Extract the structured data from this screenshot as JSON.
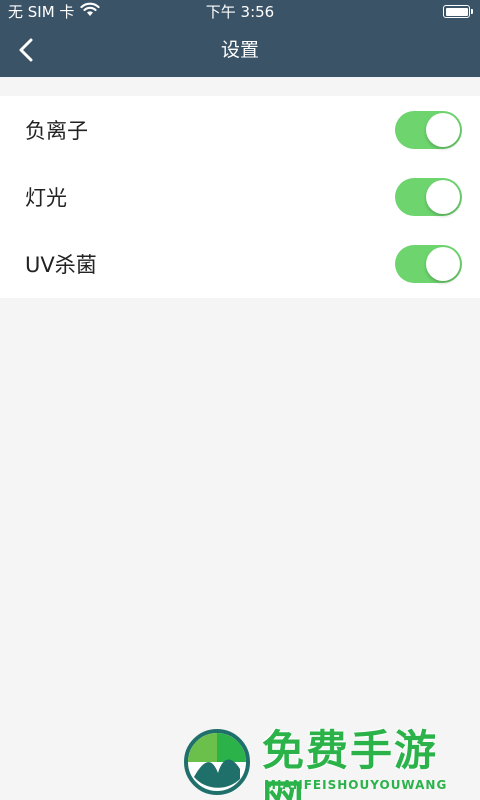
{
  "status_bar": {
    "carrier": "无 SIM 卡",
    "time": "下午 3:56",
    "wifi_icon": "wifi-icon",
    "battery_icon": "battery-icon"
  },
  "nav": {
    "title": "设置",
    "back_icon": "chevron-left-icon"
  },
  "settings": [
    {
      "label": "负离子",
      "enabled": true
    },
    {
      "label": "灯光",
      "enabled": true
    },
    {
      "label": "UV杀菌",
      "enabled": true
    }
  ],
  "colors": {
    "nav_bg": "#3b5366",
    "toggle_on": "#6dd46e",
    "page_bg": "#f5f5f5"
  },
  "watermark": {
    "title": "免费手游网",
    "subtitle": "MIANFEISHOUYOUWANG"
  }
}
